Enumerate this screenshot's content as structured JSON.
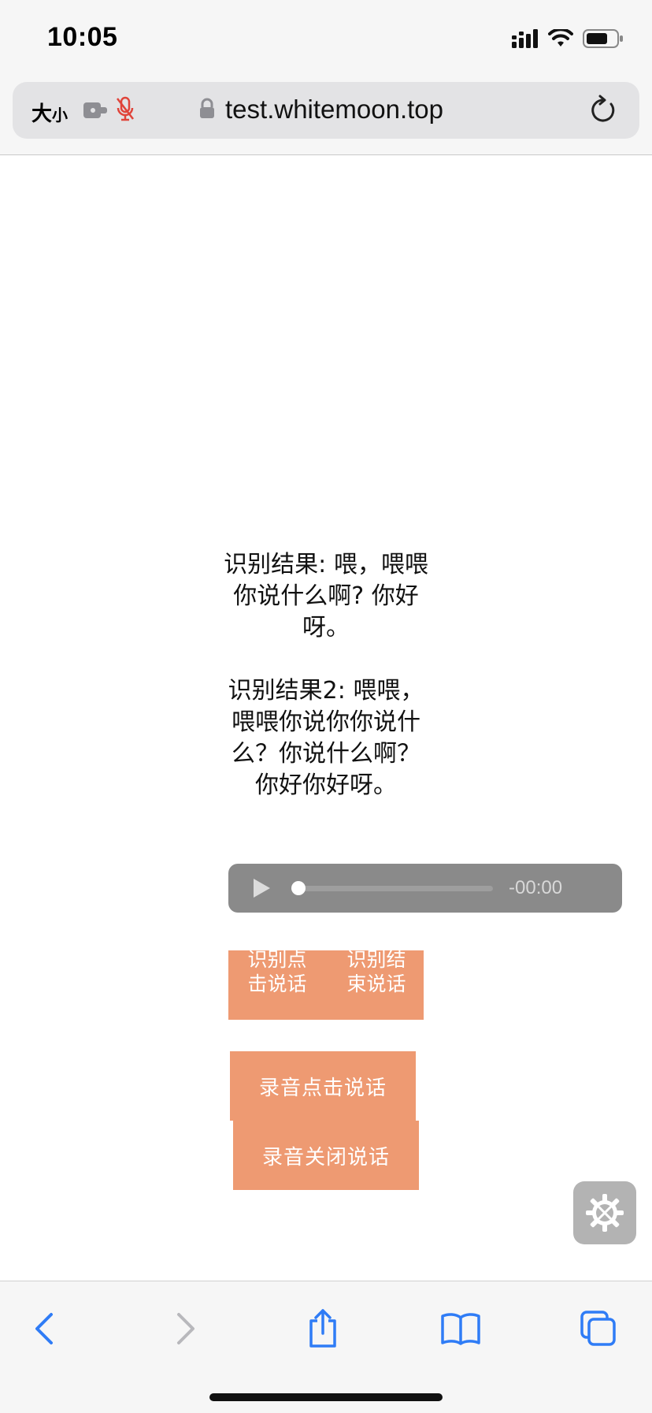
{
  "status_bar": {
    "time": "10:05",
    "icons": [
      "cellular-signal-icon",
      "wifi-icon",
      "battery-icon"
    ]
  },
  "address_bar": {
    "text_size_large": "大",
    "text_size_small": "小",
    "url": "test.whitemoon.top",
    "icons": [
      "extension-icon",
      "mic-muted-icon",
      "lock-icon",
      "reload-icon"
    ],
    "mic_muted_color": "#e0443a"
  },
  "main": {
    "result1": "识别结果: 喂，喂喂你说什么啊? 你好呀。",
    "result2": "识别结果2: 喂喂，喂喂你说你你说什么？你说什么啊？你好你好呀。",
    "audio": {
      "time": "-00:00",
      "progress": 0
    },
    "recognize_start_label": "识别点击说话",
    "recognize_end_label": "识别结束说话",
    "record_start_label": "录音点击说话",
    "record_stop_label": "录音关闭说话",
    "button_color": "#ee9a72"
  },
  "toolbar": {
    "items": [
      "back-icon",
      "forward-icon",
      "share-icon",
      "bookmarks-icon",
      "tabs-icon"
    ],
    "accent": "#2f7cf6"
  }
}
